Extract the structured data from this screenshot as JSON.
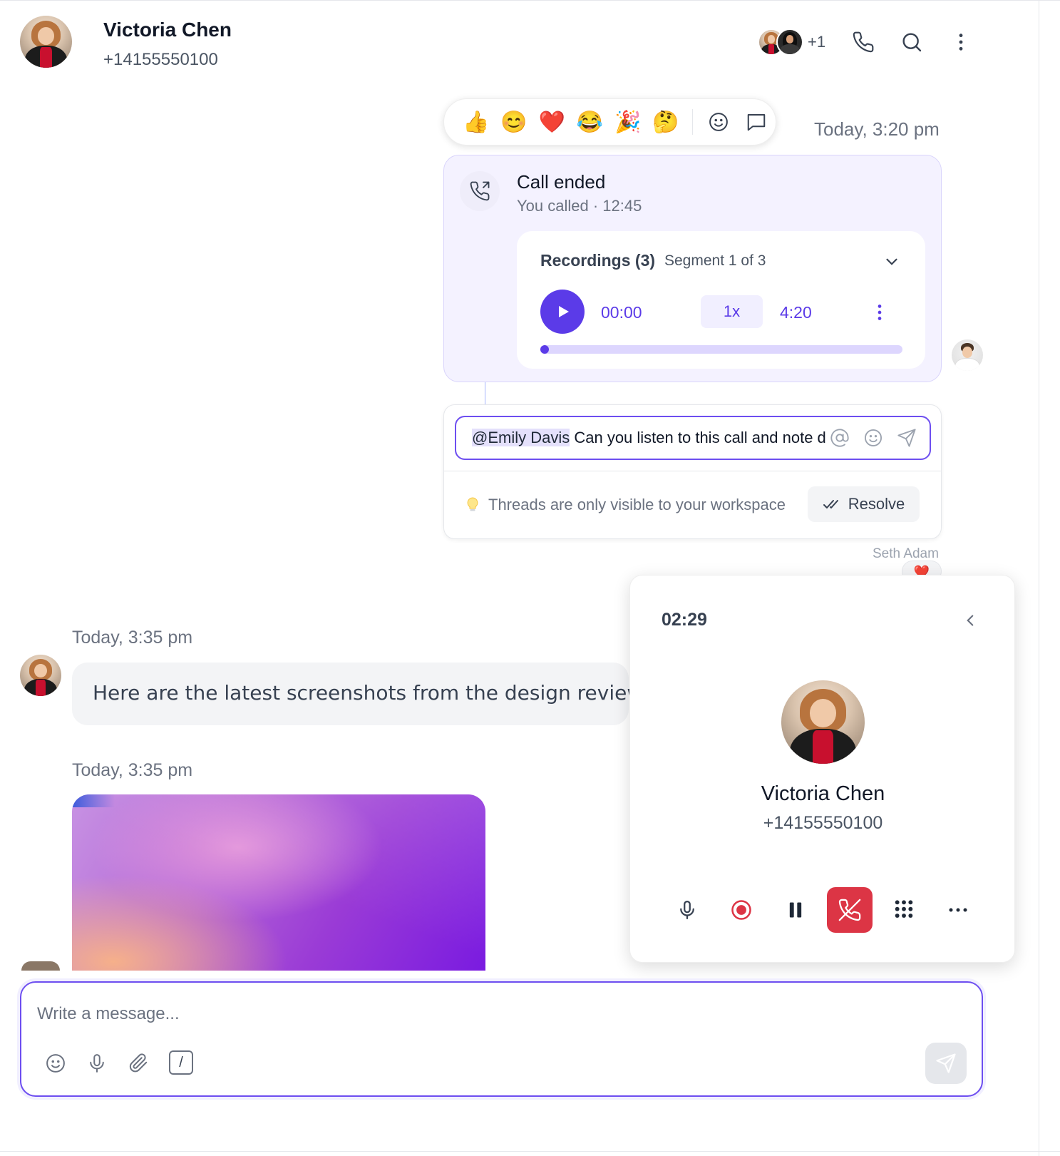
{
  "header": {
    "contact_name": "Victoria Chen",
    "contact_phone": "+14155550100",
    "participants_more": "+1",
    "icons": [
      "phone-icon",
      "search-icon",
      "more-vertical-icon"
    ]
  },
  "reactions": {
    "emojis": [
      "👍",
      "😊",
      "❤️",
      "😂",
      "🎉",
      "🤔"
    ],
    "icons": [
      "add-reaction-icon",
      "reply-thread-icon"
    ]
  },
  "call_message": {
    "timestamp": "Today, 3:20 pm",
    "title": "Call ended",
    "subtitle": "You called · 12:45",
    "recordings": {
      "title": "Recordings (3)",
      "segment": "Segment 1 of 3",
      "current_time": "00:00",
      "speed": "1x",
      "total_time": "4:20",
      "progress": 0.02
    }
  },
  "thread": {
    "mention": "@Emily Davis",
    "text": " Can you listen to this call and note d",
    "tip": "Threads are only visible to your workspace",
    "resolve_label": "Resolve",
    "sender": "Seth Adam",
    "reaction": "❤️"
  },
  "messages": [
    {
      "timestamp": "Today, 3:35 pm",
      "text": "Here are the latest screenshots from the design review"
    },
    {
      "timestamp": "Today, 3:35 pm"
    }
  ],
  "call_widget": {
    "duration": "02:29",
    "name": "Victoria Chen",
    "phone": "+14155550100",
    "controls": [
      "microphone-icon",
      "record-icon",
      "pause-icon",
      "hang-up-icon",
      "dialpad-icon",
      "more-horizontal-icon"
    ],
    "colors": {
      "record": "#dc3545",
      "hangup": "#dc3545"
    }
  },
  "composer": {
    "placeholder": "Write a message...",
    "slash_label": "/"
  },
  "colors": {
    "accent": "#5b3be8",
    "border_accent": "#6d4ef0"
  }
}
